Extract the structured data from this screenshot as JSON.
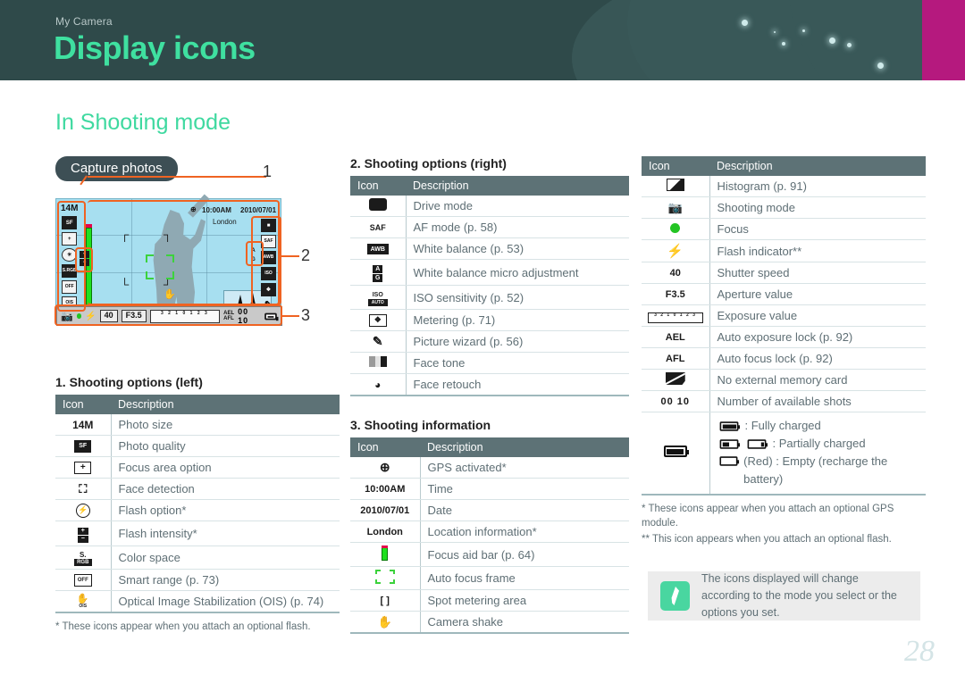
{
  "header": {
    "kicker": "My Camera",
    "title": "Display icons",
    "accent_green": "#3fe0a0",
    "banner_bg": "#2f4a4a",
    "magenta": "#b5197e"
  },
  "section": {
    "heading": "In Shooting mode",
    "pill_label": "Capture photos"
  },
  "camera_display": {
    "callout_labels": [
      "1",
      "2",
      "3"
    ],
    "osd": {
      "time": "10:00AM",
      "date": "2010/07/01",
      "location": "London",
      "photo_size": "14M",
      "photo_quality": "SF",
      "color_space": "S.RGB",
      "smart_range": "OFF",
      "ois": "OIS",
      "wb_a": "A",
      "wb_g": "G",
      "awb": "AWB",
      "iso": "ISO",
      "iso_value": "AUTO",
      "af_mode": "SAF",
      "shutter_speed": "40",
      "aperture": "F3.5",
      "ev_scale": "3 2 1 0 1 2 3",
      "ael": "AEL",
      "afl": "AFL",
      "shots": "00 10"
    }
  },
  "tables": {
    "left": {
      "title": "1. Shooting options (left)",
      "columns": [
        "Icon",
        "Description"
      ],
      "rows": [
        {
          "icon": "photo-size-icon",
          "icon_text": "14M",
          "desc": "Photo size"
        },
        {
          "icon": "photo-quality-icon",
          "icon_text": "SF",
          "desc": "Photo quality"
        },
        {
          "icon": "focus-area-icon",
          "icon_text": "+",
          "desc": "Focus area option"
        },
        {
          "icon": "face-detection-icon",
          "icon_text": "",
          "desc": "Face detection"
        },
        {
          "icon": "flash-option-icon",
          "icon_text": "",
          "desc": "Flash option*"
        },
        {
          "icon": "flash-intensity-icon",
          "icon_text": "",
          "desc": "Flash intensity*"
        },
        {
          "icon": "color-space-icon",
          "icon_text": "sRGB",
          "desc": "Color space"
        },
        {
          "icon": "smart-range-icon",
          "icon_text": "OFF",
          "desc": "Smart range (p. 73)"
        },
        {
          "icon": "ois-icon",
          "icon_text": "OIS",
          "desc": "Optical Image Stabilization (OIS) (p. 74)"
        }
      ],
      "footnote": "* These icons appear when you attach an optional flash."
    },
    "right_options": {
      "title": "2. Shooting options (right)",
      "columns": [
        "Icon",
        "Description"
      ],
      "rows": [
        {
          "icon": "drive-mode-icon",
          "icon_text": "",
          "desc": "Drive mode"
        },
        {
          "icon": "af-mode-icon",
          "icon_text": "SAF",
          "desc": "AF mode (p. 58)"
        },
        {
          "icon": "white-balance-icon",
          "icon_text": "AWB",
          "desc": "White balance (p. 53)"
        },
        {
          "icon": "wb-micro-adjust-icon",
          "icon_text": "A/G",
          "desc": "White balance micro adjustment"
        },
        {
          "icon": "iso-sensitivity-icon",
          "icon_text": "ISO AUTO",
          "desc": "ISO sensitivity (p. 52)"
        },
        {
          "icon": "metering-icon",
          "icon_text": "",
          "desc": "Metering (p. 71)"
        },
        {
          "icon": "picture-wizard-icon",
          "icon_text": "",
          "desc": "Picture wizard (p. 56)"
        },
        {
          "icon": "face-tone-icon",
          "icon_text": "",
          "desc": "Face tone"
        },
        {
          "icon": "face-retouch-icon",
          "icon_text": "",
          "desc": "Face retouch"
        }
      ]
    },
    "shooting_information": {
      "title": "3. Shooting information",
      "columns": [
        "Icon",
        "Description"
      ],
      "rows": [
        {
          "icon": "gps-icon",
          "icon_text": "",
          "desc": "GPS activated*"
        },
        {
          "icon": "time-icon",
          "icon_text": "10:00AM",
          "desc": "Time"
        },
        {
          "icon": "date-icon",
          "icon_text": "2010/07/01",
          "desc": "Date"
        },
        {
          "icon": "location-icon",
          "icon_text": "London",
          "desc": "Location information*"
        },
        {
          "icon": "focus-aid-bar-icon",
          "icon_text": "",
          "desc": "Focus aid bar (p. 64)"
        },
        {
          "icon": "auto-focus-frame-icon",
          "icon_text": "",
          "desc": "Auto focus frame"
        },
        {
          "icon": "spot-metering-icon",
          "icon_text": "[  ]",
          "desc": "Spot metering area"
        },
        {
          "icon": "camera-shake-icon",
          "icon_text": "",
          "desc": "Camera shake"
        }
      ]
    },
    "third_column": {
      "columns": [
        "Icon",
        "Description"
      ],
      "rows": [
        {
          "icon": "histogram-icon",
          "icon_text": "",
          "desc": "Histogram (p. 91)"
        },
        {
          "icon": "shooting-mode-icon",
          "icon_text": "",
          "desc": "Shooting mode"
        },
        {
          "icon": "focus-dot-icon",
          "icon_text": "",
          "desc": "Focus"
        },
        {
          "icon": "flash-indicator-icon",
          "icon_text": "",
          "desc": "Flash indicator**"
        },
        {
          "icon": "shutter-speed-icon",
          "icon_text": "40",
          "desc": "Shutter speed"
        },
        {
          "icon": "aperture-icon",
          "icon_text": "F3.5",
          "desc": "Aperture value"
        },
        {
          "icon": "exposure-value-icon",
          "icon_text": "3 2 1 0 1 2 3",
          "desc": "Exposure value"
        },
        {
          "icon": "ael-icon",
          "icon_text": "AEL",
          "desc": "Auto exposure lock (p. 92)"
        },
        {
          "icon": "afl-icon",
          "icon_text": "AFL",
          "desc": "Auto focus lock (p. 92)"
        },
        {
          "icon": "no-memory-card-icon",
          "icon_text": "",
          "desc": "No external memory card"
        },
        {
          "icon": "available-shots-icon",
          "icon_text": "00 10",
          "desc": "Number of available shots"
        }
      ],
      "battery_row": {
        "icon": "battery-icon",
        "lines": [
          ": Fully charged",
          ": Partially charged",
          "(Red) : Empty (recharge the battery)"
        ]
      },
      "footnotes": [
        "* These icons appear when you attach an optional GPS module.",
        "** This icon appears when you attach an optional flash."
      ]
    }
  },
  "note": {
    "icon": "pen-note-icon",
    "text": "The icons displayed will change according to the mode you select or the options you set."
  },
  "page_number": "28"
}
